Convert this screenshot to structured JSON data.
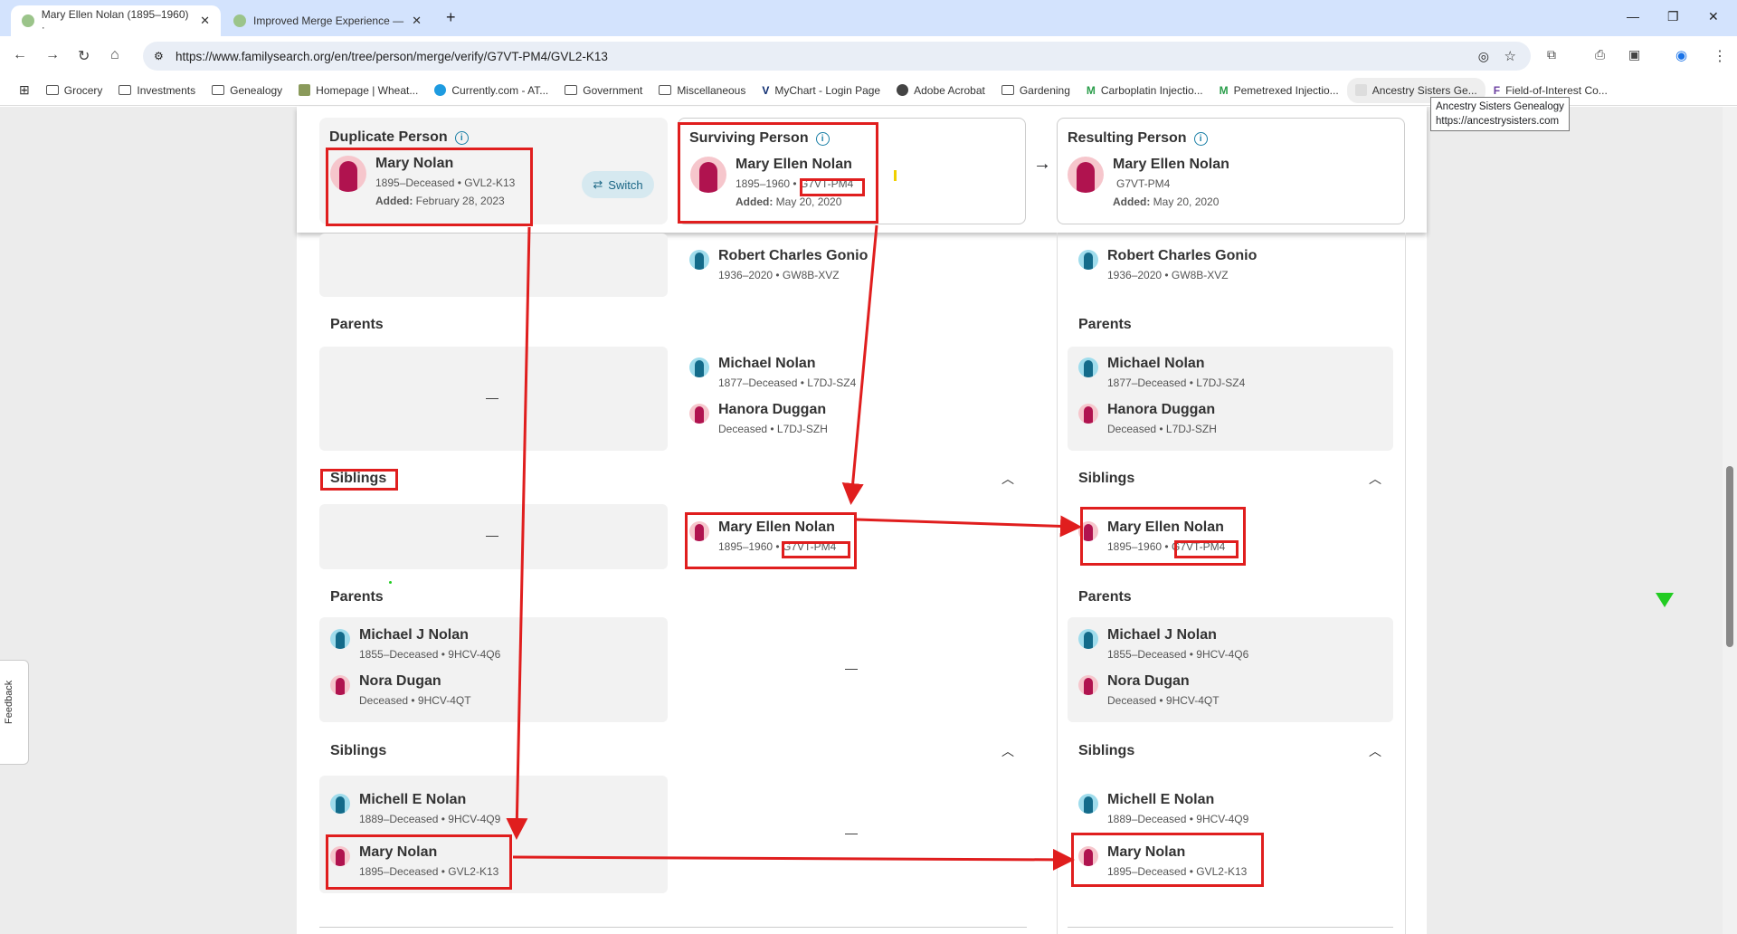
{
  "browser": {
    "tabs": [
      {
        "label": "Mary Ellen Nolan (1895–1960) ·",
        "active": true
      },
      {
        "label": "Improved Merge Experience —",
        "active": false
      }
    ],
    "new_tab": "+",
    "url": "https://www.familysearch.org/en/tree/person/merge/verify/G7VT-PM4/GVL2-K13",
    "bookmarks": [
      "Grocery",
      "Investments",
      "Genealogy",
      "Homepage | Wheat...",
      "Currently.com - AT...",
      "Government",
      "Miscellaneous",
      "MyChart - Login Page",
      "Adobe Acrobat",
      "Gardening",
      "Carboplatin Injectio...",
      "Pemetrexed Injectio...",
      "Ancestry Sisters Ge...",
      "Field-of-Interest Co..."
    ],
    "tooltip": {
      "title": "Ancestry Sisters Genealogy",
      "url": "https://ancestrysisters.com"
    }
  },
  "header": {
    "duplicate": {
      "title": "Duplicate Person",
      "name": "Mary Nolan",
      "detail": "1895–Deceased • GVL2-K13",
      "added_label": "Added:",
      "added": "February 28, 2023"
    },
    "switch_label": "Switch",
    "surviving": {
      "title": "Surviving Person",
      "name": "Mary Ellen Nolan",
      "years": "1895–1960 •",
      "id": "G7VT-PM4",
      "added_label": "Added:",
      "added": "May 20, 2020"
    },
    "resulting": {
      "title": "Resulting Person",
      "name": "Mary Ellen Nolan",
      "id": "G7VT-PM4",
      "added_label": "Added:",
      "added": "May 20, 2020"
    }
  },
  "spouse": {
    "name": "Robert Charles Gonio",
    "detail": "1936–2020 • GW8B-XVZ"
  },
  "section1": {
    "parents_label": "Parents",
    "empty": "—",
    "father": {
      "name": "Michael Nolan",
      "detail": "1877–Deceased • L7DJ-SZ4"
    },
    "mother": {
      "name": "Hanora Duggan",
      "detail": "Deceased • L7DJ-SZH"
    },
    "siblings_label": "Siblings",
    "sibling": {
      "name": "Mary Ellen Nolan",
      "years": "1895–1960 •",
      "id": "G7VT-PM4"
    }
  },
  "section2": {
    "parents_label": "Parents",
    "empty": "—",
    "father": {
      "name": "Michael J Nolan",
      "detail": "1855–Deceased • 9HCV-4Q6"
    },
    "mother": {
      "name": "Nora Dugan",
      "detail": "Deceased • 9HCV-4QT"
    },
    "siblings_label": "Siblings",
    "sib1": {
      "name": "Michell E Nolan",
      "detail": "1889–Deceased • 9HCV-4Q9"
    },
    "sib2": {
      "name": "Mary Nolan",
      "detail": "1895–Deceased • GVL2-K13"
    }
  },
  "feedback_label": "Feedback",
  "colors": {
    "annotation": "#e01e1e",
    "female": "#b0134f",
    "male": "#136b8a",
    "info": "#1a7fa6"
  }
}
